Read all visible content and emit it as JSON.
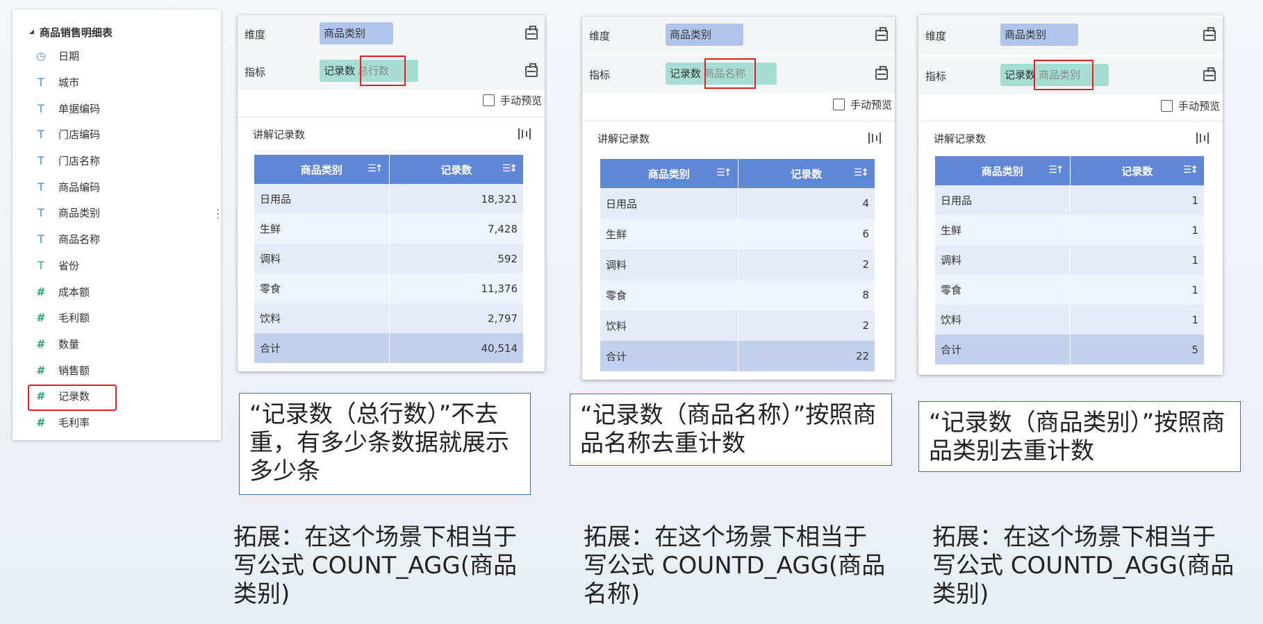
{
  "sidebar": {
    "title": "商品销售明细表",
    "items": [
      {
        "label": "日期",
        "icon": "clock-icon",
        "glyph": "◷",
        "type": "date"
      },
      {
        "label": "城市",
        "icon": "text-field-icon",
        "glyph": "T",
        "type": "text"
      },
      {
        "label": "单据编码",
        "icon": "text-field-icon",
        "glyph": "T",
        "type": "text"
      },
      {
        "label": "门店编码",
        "icon": "text-field-icon",
        "glyph": "T",
        "type": "text"
      },
      {
        "label": "门店名称",
        "icon": "text-field-icon",
        "glyph": "T",
        "type": "text"
      },
      {
        "label": "商品编码",
        "icon": "text-field-icon",
        "glyph": "T",
        "type": "text"
      },
      {
        "label": "商品类别",
        "icon": "text-field-icon",
        "glyph": "T",
        "type": "text"
      },
      {
        "label": "商品名称",
        "icon": "text-field-icon",
        "glyph": "T",
        "type": "text"
      },
      {
        "label": "省份",
        "icon": "text-field-icon",
        "glyph": "T",
        "type": "text"
      },
      {
        "label": "成本额",
        "icon": "number-field-icon",
        "glyph": "#",
        "type": "num"
      },
      {
        "label": "毛利额",
        "icon": "number-field-icon",
        "glyph": "#",
        "type": "num"
      },
      {
        "label": "数量",
        "icon": "number-field-icon",
        "glyph": "#",
        "type": "num"
      },
      {
        "label": "销售额",
        "icon": "number-field-icon",
        "glyph": "#",
        "type": "num"
      },
      {
        "label": "记录数",
        "icon": "computed-number-icon",
        "glyph": "#",
        "type": "num",
        "highlighted": true
      },
      {
        "label": "毛利率",
        "icon": "formula-field-icon",
        "glyph": "#",
        "type": "num"
      }
    ]
  },
  "panels": [
    {
      "dimension_label": "维度",
      "dimension_value": "商品类别",
      "measure_label": "指标",
      "measure_value": "记录数",
      "measure_sub": "总行数",
      "preview_label": "手动预览",
      "inner_title": "讲解记录数",
      "col1": "商品类别",
      "col2": "记录数",
      "rows": [
        [
          "日用品",
          "18,321"
        ],
        [
          "生鲜",
          "7,428"
        ],
        [
          "调料",
          "592"
        ],
        [
          "零食",
          "11,376"
        ],
        [
          "饮料",
          "2,797"
        ]
      ],
      "total_label": "合计",
      "total_value": "40,514"
    },
    {
      "dimension_label": "维度",
      "dimension_value": "商品类别",
      "measure_label": "指标",
      "measure_value": "记录数",
      "measure_sub": "商品名称",
      "preview_label": "手动预览",
      "inner_title": "讲解记录数",
      "col1": "商品类别",
      "col2": "记录数",
      "rows": [
        [
          "日用品",
          "4"
        ],
        [
          "生鲜",
          "6"
        ],
        [
          "调料",
          "2"
        ],
        [
          "零食",
          "8"
        ],
        [
          "饮料",
          "2"
        ]
      ],
      "total_label": "合计",
      "total_value": "22"
    },
    {
      "dimension_label": "维度",
      "dimension_value": "商品类别",
      "measure_label": "指标",
      "measure_value": "记录数",
      "measure_sub": "商品类别",
      "preview_label": "手动预览",
      "inner_title": "讲解记录数",
      "col1": "商品类别",
      "col2": "记录数",
      "rows": [
        [
          "日用品",
          "1"
        ],
        [
          "生鲜",
          "1"
        ],
        [
          "调料",
          "1"
        ],
        [
          "零食",
          "1"
        ],
        [
          "饮料",
          "1"
        ]
      ],
      "total_label": "合计",
      "total_value": "5"
    }
  ],
  "notes": [
    "“记录数（总行数）”不去重，有多少条数据就展示多少条",
    "“记录数（商品名称）”按照商品名称去重计数",
    "“记录数（商品类别）”按照商品类别去重计数"
  ],
  "extensions": [
    "拓展：在这个场景下相当于写公式 COUNT_AGG(商品类别)",
    "拓展：在这个场景下相当于写公式 COUNTD_AGG(商品名称)",
    "拓展：在这个场景下相当于写公式 COUNTD_AGG(商品类别)"
  ]
}
